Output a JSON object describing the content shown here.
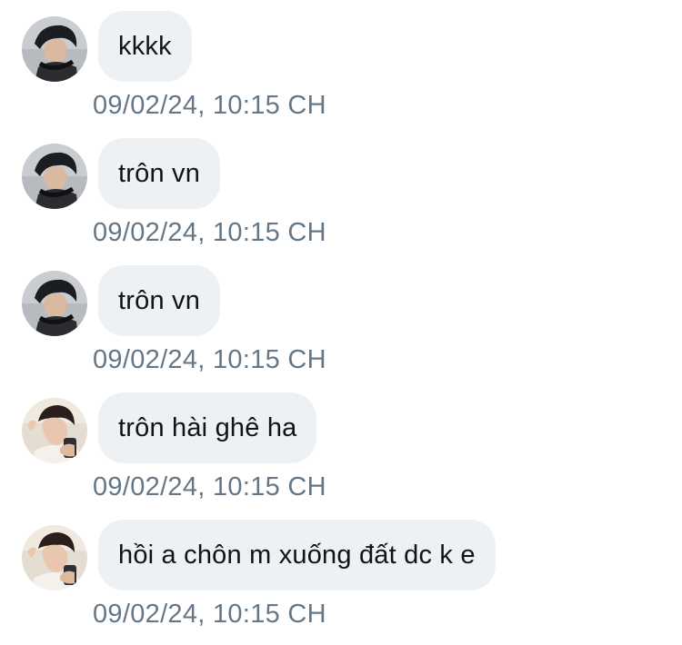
{
  "messages": [
    {
      "text": "kkkk",
      "time": "09/02/24, 10:15 CH",
      "avatar": "avatar-1"
    },
    {
      "text": "trôn vn",
      "time": "09/02/24, 10:15 CH",
      "avatar": "avatar-1"
    },
    {
      "text": "trôn vn",
      "time": "09/02/24, 10:15 CH",
      "avatar": "avatar-1"
    },
    {
      "text": "trôn hài ghê ha",
      "time": "09/02/24, 10:15 CH",
      "avatar": "avatar-2"
    },
    {
      "text": "hồi a chôn m xuống đất dc k e",
      "time": "09/02/24, 10:15 CH",
      "avatar": "avatar-2"
    }
  ],
  "colors": {
    "bubble": "#eef1f4",
    "text": "#0f1419",
    "timestamp": "#657786",
    "background": "#ffffff"
  }
}
